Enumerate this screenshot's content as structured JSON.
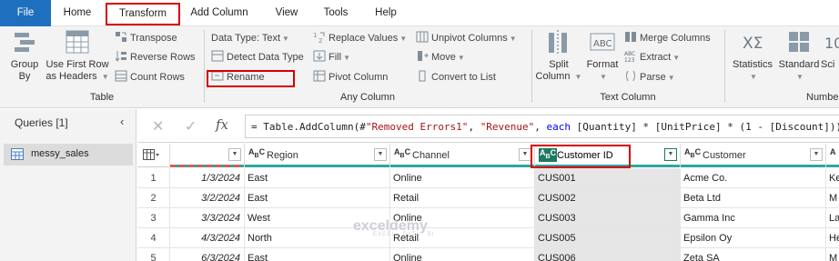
{
  "tabs": [
    "File",
    "Home",
    "Transform",
    "Add Column",
    "View",
    "Tools",
    "Help"
  ],
  "ribbon": {
    "table_group": {
      "label": "Table",
      "group_by": "Group\nBy",
      "use_first_row": "Use First Row\nas Headers",
      "transpose": "Transpose",
      "reverse_rows": "Reverse Rows",
      "count_rows": "Count Rows"
    },
    "any_column_group": {
      "label": "Any Column",
      "data_type": "Data Type: Text",
      "detect_data_type": "Detect Data Type",
      "rename": "Rename",
      "replace_values": "Replace Values",
      "fill": "Fill",
      "pivot_column": "Pivot Column",
      "unpivot_columns": "Unpivot Columns",
      "move": "Move",
      "convert_to_list": "Convert to List"
    },
    "text_column_group": {
      "label": "Text Column",
      "split_column": "Split\nColumn",
      "format": "Format",
      "merge_columns": "Merge Columns",
      "extract": "Extract",
      "parse": "Parse"
    },
    "number_group": {
      "label": "Numbe",
      "statistics": "Statistics",
      "standard": "Standard",
      "scientific": "Sci"
    }
  },
  "queries": {
    "title": "Queries [1]",
    "items": [
      "messy_sales"
    ]
  },
  "formula_bar": {
    "cancel": "✕",
    "commit": "✓",
    "fx": "fx",
    "prefix": "= Table.AddColumn(#",
    "str1": "\"Removed Errors1\"",
    "comma": ", ",
    "str2": "\"Revenue\"",
    "comma2": ", ",
    "kw": "each",
    "rest": " [Quantity] * [UnitPrice] * (1 - [Discount]))"
  },
  "grid": {
    "columns": [
      {
        "type_icon": "A B C",
        "name": "Region"
      },
      {
        "type_icon": "A B C",
        "name": "Channel"
      },
      {
        "type_icon": "A B C",
        "name": "Customer ID"
      },
      {
        "type_icon": "A B C",
        "name": "Customer"
      }
    ],
    "rows": [
      {
        "n": "1",
        "date": "1/3/2024",
        "region": "East",
        "channel": "Online",
        "cid": "CUS001",
        "customer": "Acme Co.",
        "extra": "Ke"
      },
      {
        "n": "2",
        "date": "3/2/2024",
        "region": "East",
        "channel": "Retail",
        "cid": "CUS002",
        "customer": "Beta Ltd",
        "extra": "M"
      },
      {
        "n": "3",
        "date": "3/3/2024",
        "region": "West",
        "channel": "Online",
        "cid": "CUS003",
        "customer": "Gamma Inc",
        "extra": "La"
      },
      {
        "n": "4",
        "date": "4/3/2024",
        "region": "North",
        "channel": "Retail",
        "cid": "CUS005",
        "customer": "Epsilon Oy",
        "extra": "He"
      },
      {
        "n": "5",
        "date": "6/3/2024",
        "region": "East",
        "channel": "Online",
        "cid": "CUS006",
        "customer": "Zeta SA",
        "extra": "M"
      }
    ]
  },
  "watermark": {
    "brand": "exceldemy",
    "tag": "EXCEL · DATA · BI"
  },
  "colors": {
    "file_tab": "#1f6fbf",
    "highlight": "#d40000",
    "quality_bar": "#2ea6a0"
  }
}
